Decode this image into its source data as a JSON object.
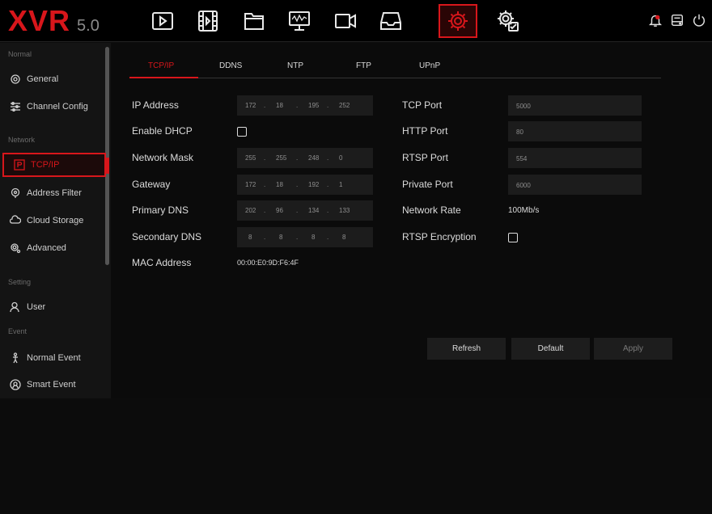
{
  "app": {
    "brand": "XVR",
    "version": "5.0"
  },
  "topbar": {
    "icons": [
      "playback-icon",
      "video-clip-icon",
      "file-folder-icon",
      "monitor-icon",
      "camera-icon",
      "storage-icon",
      "settings-gear-icon",
      "system-settings-icon"
    ],
    "right_icons": [
      "alarm-bell-icon",
      "hdd-icon",
      "power-icon"
    ],
    "accent": "#d8161b"
  },
  "sidebar": {
    "sections": [
      "Normal",
      "Network",
      "Setting",
      "Event"
    ],
    "items": {
      "general": "General",
      "channel_config": "Channel Config",
      "tcpip": "TCP/IP",
      "address_filter": "Address Filter",
      "cloud_storage": "Cloud Storage",
      "advanced": "Advanced",
      "user": "User",
      "normal_event": "Normal Event",
      "smart_event": "Smart Event"
    }
  },
  "tabs": [
    "TCP/IP",
    "DDNS",
    "NTP",
    "FTP",
    "UPnP"
  ],
  "form": {
    "left": {
      "ip_address": {
        "label": "IP Address",
        "octets": [
          "172",
          "18",
          "195",
          "252"
        ]
      },
      "enable_dhcp": {
        "label": "Enable DHCP",
        "checked": false
      },
      "network_mask": {
        "label": "Network Mask",
        "octets": [
          "255",
          "255",
          "248",
          "0"
        ]
      },
      "gateway": {
        "label": "Gateway",
        "octets": [
          "172",
          "18",
          "192",
          "1"
        ]
      },
      "primary_dns": {
        "label": "Primary DNS",
        "octets": [
          "202",
          "96",
          "134",
          "133"
        ]
      },
      "secondary_dns": {
        "label": "Secondary DNS",
        "octets": [
          "8",
          "8",
          "8",
          "8"
        ]
      },
      "mac_address": {
        "label": "MAC Address",
        "value": "00:00:E0:9D:F6:4F"
      }
    },
    "right": {
      "tcp_port": {
        "label": "TCP Port",
        "value": "5000"
      },
      "http_port": {
        "label": "HTTP Port",
        "value": "80"
      },
      "rtsp_port": {
        "label": "RTSP Port",
        "value": "554"
      },
      "private_port": {
        "label": "Private Port",
        "value": "6000"
      },
      "network_rate": {
        "label": "Network Rate",
        "value": "100Mb/s"
      },
      "rtsp_encryption": {
        "label": "RTSP Encryption",
        "checked": false
      }
    },
    "dot": "."
  },
  "buttons": {
    "refresh": "Refresh",
    "default": "Default",
    "apply": "Apply"
  }
}
